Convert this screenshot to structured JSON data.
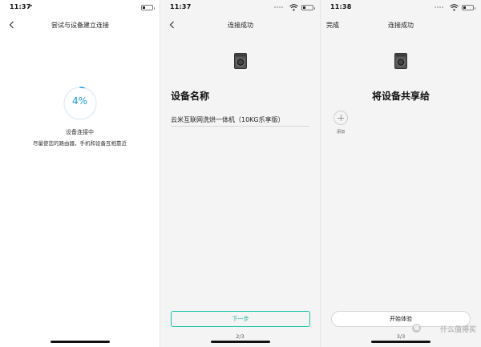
{
  "screens": [
    {
      "status": {
        "time": "11:37",
        "location_glyph": "➚"
      },
      "nav": {
        "title": "尝试与设备建立连接"
      },
      "progress": {
        "text": "4%",
        "value": 0.04
      },
      "connecting_text": "设备连接中",
      "hint_text": "尽量使您的路由器，手机和设备互相靠近"
    },
    {
      "status": {
        "time": "11:37"
      },
      "nav": {
        "title": "连接成功"
      },
      "section_title": "设备名称",
      "device_name": "云米互联网洗烘一体机（10KG乐享版）",
      "next_label": "下一步",
      "pager": "2/3"
    },
    {
      "status": {
        "time": "11:38"
      },
      "nav": {
        "title": "连接成功",
        "done_label": "完成"
      },
      "section_title": "将设备共享给",
      "add_label": "添加",
      "start_label": "开始体验",
      "pager": "3/3",
      "watermark": {
        "glyph": "值",
        "text": "什么值得买"
      }
    }
  ],
  "colors": {
    "accent": "#1a9bdc",
    "button_green": "#19b89d"
  },
  "icons": [
    "back-chevron-icon",
    "wifi-icon",
    "battery-icon",
    "washer-icon",
    "plus-icon"
  ]
}
